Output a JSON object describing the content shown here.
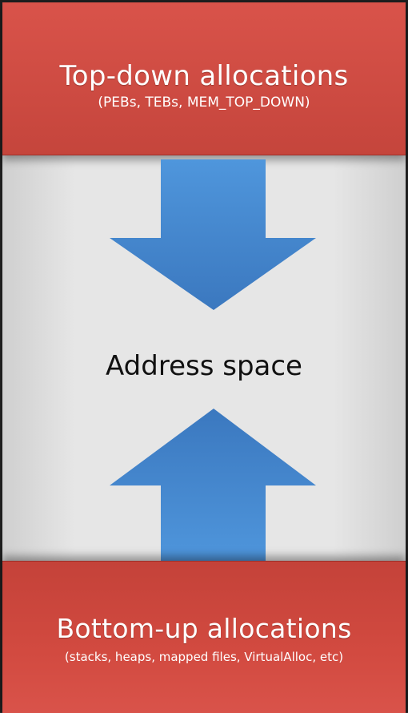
{
  "top_band": {
    "title": "Top-down allocations",
    "subtitle": "(PEBs, TEBs, MEM_TOP_DOWN)"
  },
  "middle": {
    "label": "Address space"
  },
  "bottom_band": {
    "title": "Bottom-up allocations",
    "subtitle": "(stacks, heaps, mapped files, VirtualAlloc, etc)"
  },
  "arrows": {
    "down": {
      "icon": "down-arrow-icon",
      "color": "#4a8fd6"
    },
    "up": {
      "icon": "up-arrow-icon",
      "color": "#4a8fd6"
    }
  },
  "colors": {
    "band": "#d9534a",
    "arrow": "#4a8fd6",
    "background": "#e6e6e6"
  }
}
